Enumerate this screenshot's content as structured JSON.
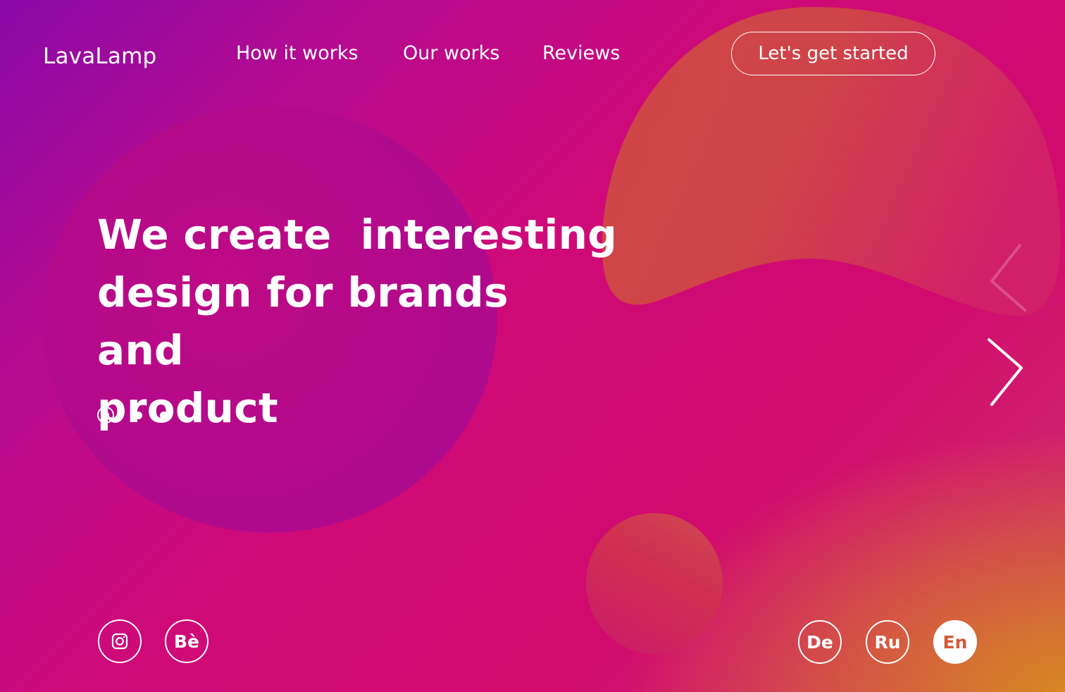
{
  "brand": {
    "logo": "LavaLamp"
  },
  "nav": {
    "items": [
      {
        "label": "How it works"
      },
      {
        "label": "Our works"
      },
      {
        "label": "Reviews"
      }
    ],
    "cta_label": "Let's get started"
  },
  "hero": {
    "title_lines": [
      "We create  interesting",
      "design for brands and",
      "product"
    ]
  },
  "slider": {
    "total_slides": 3,
    "active_slide": 1,
    "prev_icon": "chevron-left-icon",
    "next_icon": "chevron-right-icon"
  },
  "social": {
    "items": [
      {
        "name": "instagram",
        "icon": "instagram-icon"
      },
      {
        "name": "behance",
        "label": "Bè"
      }
    ]
  },
  "languages": {
    "items": [
      {
        "code": "De"
      },
      {
        "code": "Ru"
      },
      {
        "code": "En"
      }
    ],
    "selected": "En"
  },
  "colors": {
    "background_start": "#8a0aa8",
    "background_mid": "#d10a6e",
    "background_end_accent": "#d68c1e",
    "text": "#ffffff",
    "active_lang_text": "#d35a3c"
  }
}
